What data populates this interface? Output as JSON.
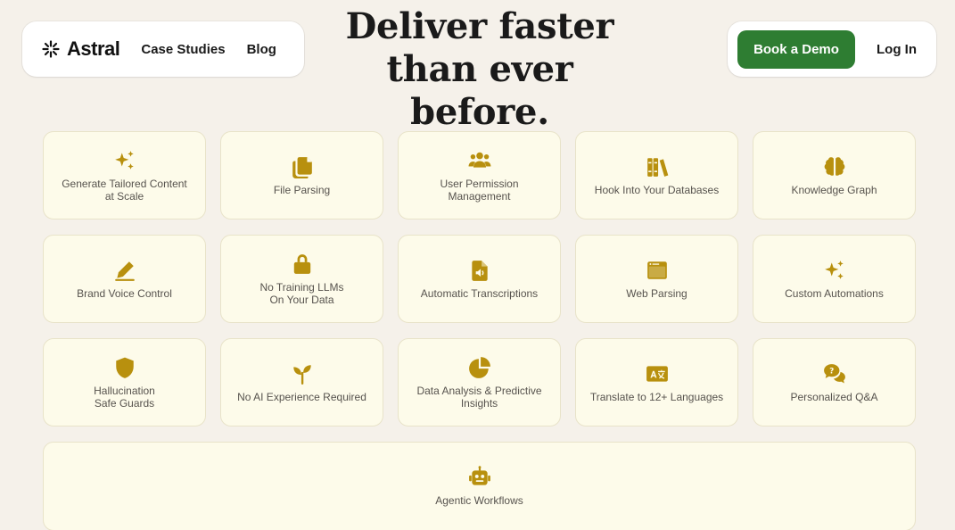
{
  "nav": {
    "brand": "Astral",
    "links": [
      "Case Studies",
      "Blog"
    ],
    "demo_button": "Book a Demo",
    "login_button": "Log In"
  },
  "hero": {
    "line1": "Deliver faster",
    "line2": "than ever before."
  },
  "accent_colors": {
    "icon": "#b8900e",
    "primary_button": "#2e7d32",
    "card_background": "#fdfbea",
    "page_background": "#f5f1ea"
  },
  "features": [
    {
      "label": "Generate Tailored Content\nat Scale",
      "icon": "sparkles-icon"
    },
    {
      "label": "File Parsing",
      "icon": "copy-files-icon"
    },
    {
      "label": "User Permission\nManagement",
      "icon": "users-icon"
    },
    {
      "label": "Hook Into Your Databases",
      "icon": "books-icon"
    },
    {
      "label": "Knowledge Graph",
      "icon": "brain-icon"
    },
    {
      "label": "Brand Voice Control",
      "icon": "pen-icon"
    },
    {
      "label": "No Training LLMs\nOn Your Data",
      "icon": "lock-icon"
    },
    {
      "label": "Automatic Transcriptions",
      "icon": "audio-file-icon"
    },
    {
      "label": "Web Parsing",
      "icon": "browser-window-icon"
    },
    {
      "label": "Custom Automations",
      "icon": "sparkles-icon"
    },
    {
      "label": "Hallucination\nSafe Guards",
      "icon": "shield-icon"
    },
    {
      "label": "No AI Experience Required",
      "icon": "seedling-icon"
    },
    {
      "label": "Data Analysis & Predictive\nInsights",
      "icon": "pie-chart-icon"
    },
    {
      "label": "Translate to 12+ Languages",
      "icon": "language-icon"
    },
    {
      "label": "Personalized Q&A",
      "icon": "question-chat-icon"
    },
    {
      "label": "Agentic Workflows",
      "icon": "robot-icon"
    }
  ]
}
